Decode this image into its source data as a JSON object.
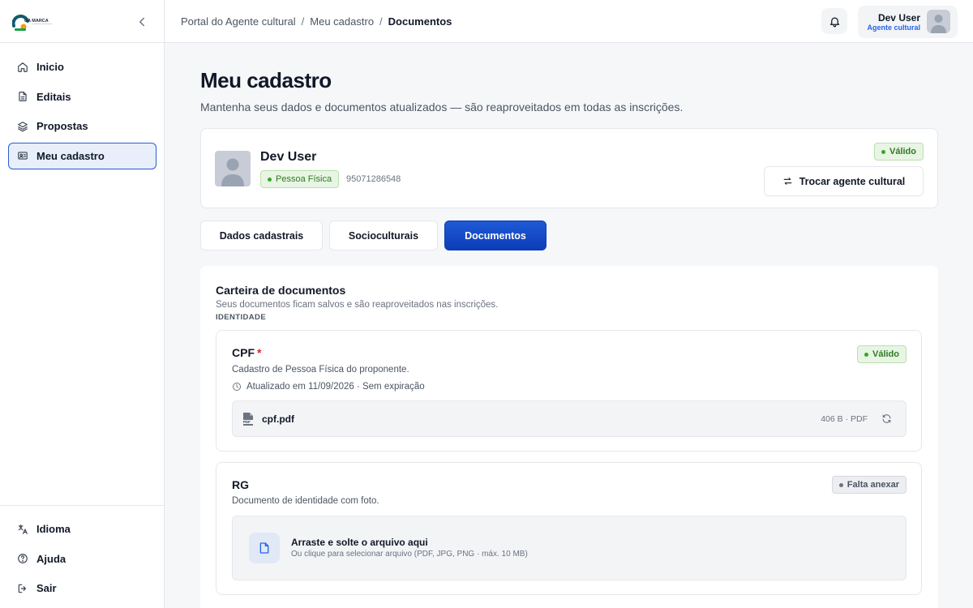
{
  "brand": {
    "logo_text": "UA MARCA"
  },
  "sidebar": {
    "items": [
      {
        "label": "Inicio",
        "icon": "home-icon"
      },
      {
        "label": "Editais",
        "icon": "document-icon"
      },
      {
        "label": "Propostas",
        "icon": "layers-icon"
      },
      {
        "label": "Meu cadastro",
        "icon": "id-card-icon",
        "active": true
      }
    ],
    "bottom_items": [
      {
        "label": "Idioma",
        "icon": "translate-icon"
      },
      {
        "label": "Ajuda",
        "icon": "help-circle-icon"
      },
      {
        "label": "Sair",
        "icon": "logout-icon"
      }
    ]
  },
  "header": {
    "breadcrumbs": [
      "Portal do Agente cultural",
      "Meu cadastro",
      "Documentos"
    ],
    "separator": "/",
    "user": {
      "name": "Dev User",
      "role": "Agente cultural"
    }
  },
  "page": {
    "title": "Meu cadastro",
    "subtitle": "Mantenha seus dados e documentos atualizados — são reaproveitados em todas as inscrições."
  },
  "profile": {
    "name": "Dev User",
    "type": "Pessoa Física",
    "id_number": "95071286548",
    "status": "Válido",
    "swap_label": "Trocar agente cultural"
  },
  "tabs": [
    {
      "label": "Dados cadastrais"
    },
    {
      "label": "Socioculturais"
    },
    {
      "label": "Documentos",
      "active": true
    }
  ],
  "documents": {
    "title": "Carteira de documentos",
    "subtitle": "Seus documentos ficam salvos e são reaproveitados nas inscrições.",
    "section": "IDENTIDADE",
    "cpf": {
      "name": "CPF",
      "required_mark": "*",
      "description": "Cadastro de Pessoa Física do proponente.",
      "updated": "Atualizado em 11/09/2026 · Sem expiração",
      "status": "Válido",
      "file": {
        "name": "cpf.pdf",
        "meta": "406 B · PDF",
        "icon_label": "PDF"
      }
    },
    "rg": {
      "name": "RG",
      "description": "Documento de identidade com foto.",
      "status": "Falta anexar",
      "dropzone": {
        "title": "Arraste e solte o arquivo aqui",
        "hint": "Ou clique para selecionar arquivo (PDF, JPG, PNG · máx. 10 MB)"
      }
    }
  },
  "colors": {
    "accent": "#0c3db8",
    "active_nav_bg": "#e8effb",
    "valid_green": "#2f7a22",
    "required_red": "#dc2626",
    "role_blue": "#2563eb"
  }
}
